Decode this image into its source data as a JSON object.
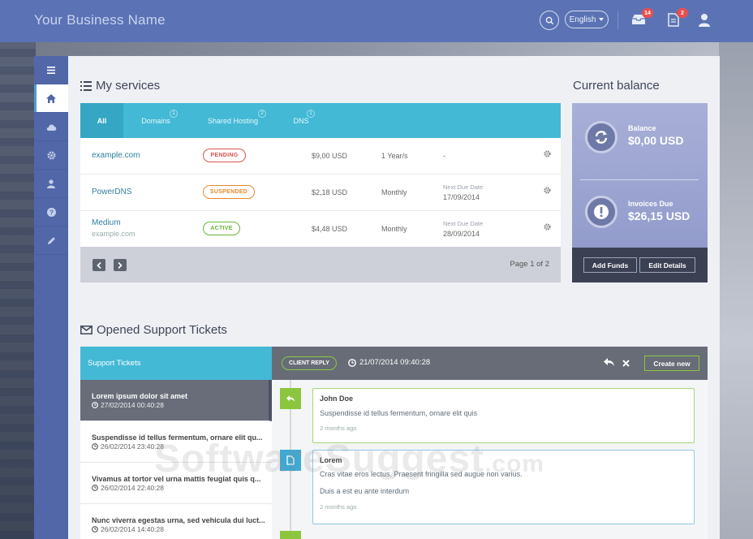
{
  "topbar": {
    "brand": "Your Business Name",
    "language": "English",
    "inbox_count": "14",
    "docs_count": "2"
  },
  "sidebar": {
    "items": [
      {
        "icon": "menu-icon"
      },
      {
        "icon": "home-icon",
        "active": true
      },
      {
        "icon": "cloud-icon"
      },
      {
        "icon": "gear-icon"
      },
      {
        "icon": "user-icon"
      },
      {
        "icon": "help-icon"
      },
      {
        "icon": "pencil-icon"
      }
    ]
  },
  "services": {
    "title": "My services",
    "tabs": [
      {
        "label": "All",
        "count": ""
      },
      {
        "label": "Domains",
        "count": "1"
      },
      {
        "label": "Shared Hosting",
        "count": "2"
      },
      {
        "label": "DNS",
        "count": "1"
      }
    ],
    "rows": [
      {
        "name": "example.com",
        "sub": "",
        "status": "PENDING",
        "price": "$9,00 USD",
        "cycle": "1 Year/s",
        "due_label": "",
        "due": "-"
      },
      {
        "name": "PowerDNS",
        "sub": "",
        "status": "SUSPENDED",
        "price": "$2,18 USD",
        "cycle": "Monthly",
        "due_label": "Next Due Date",
        "due": "17/09/2014"
      },
      {
        "name": "Medium",
        "sub": "example.com",
        "status": "ACTIVE",
        "price": "$4,48 USD",
        "cycle": "Monthly",
        "due_label": "Next Due Date",
        "due": "28/09/2014"
      }
    ],
    "page_text": "Page 1 of 2"
  },
  "balance": {
    "title": "Current balance",
    "balance_label": "Balance",
    "balance_value": "$0,00 USD",
    "invoices_label": "Invoices Due",
    "invoices_value": "$26,15 USD",
    "add_funds": "Add Funds",
    "edit_details": "Edit Details"
  },
  "tickets": {
    "title": "Opened Support Tickets",
    "list_header": "Support Tickets",
    "status_badge": "CLIENT REPLY",
    "selected_date": "21/07/2014 09:40:28",
    "create_new": "Create new",
    "items": [
      {
        "subject": "Lorem ipsum dolor sit amet",
        "date": "27/02/2014 00:40:28"
      },
      {
        "subject": "Suspendisse id tellus fermentum, ornare elit qu...",
        "date": "26/02/2014 23:40:28"
      },
      {
        "subject": "Vivamus at tortor vel urna mattis feugiat quis q...",
        "date": "26/02/2014 22:40:28"
      },
      {
        "subject": "Nunc viverra egestas urna, sed vehicula dui luct...",
        "date": "26/02/2014 14:40:28"
      }
    ],
    "messages": [
      {
        "author": "John Doe",
        "lines": [
          "Suspendisse id tellus fermentum, ornare elit quis"
        ],
        "time": "2 months ago"
      },
      {
        "author": "Lorem",
        "lines": [
          "Cras vitae eros lectus. Praesent fringilla sed augue non varius.",
          "Duis a est eu ante interdum"
        ],
        "time": "2 months ago"
      }
    ]
  },
  "watermark": {
    "main": "SoftwareSuggest",
    "suffix": ".com"
  },
  "colors": {
    "topbar": "#5b73b5",
    "sidebar": "#5167a8",
    "tabs": "#43b9d6",
    "pending": "#d9534f",
    "suspended": "#e48a2b",
    "active": "#6ab536",
    "link": "#2f7f9d"
  }
}
